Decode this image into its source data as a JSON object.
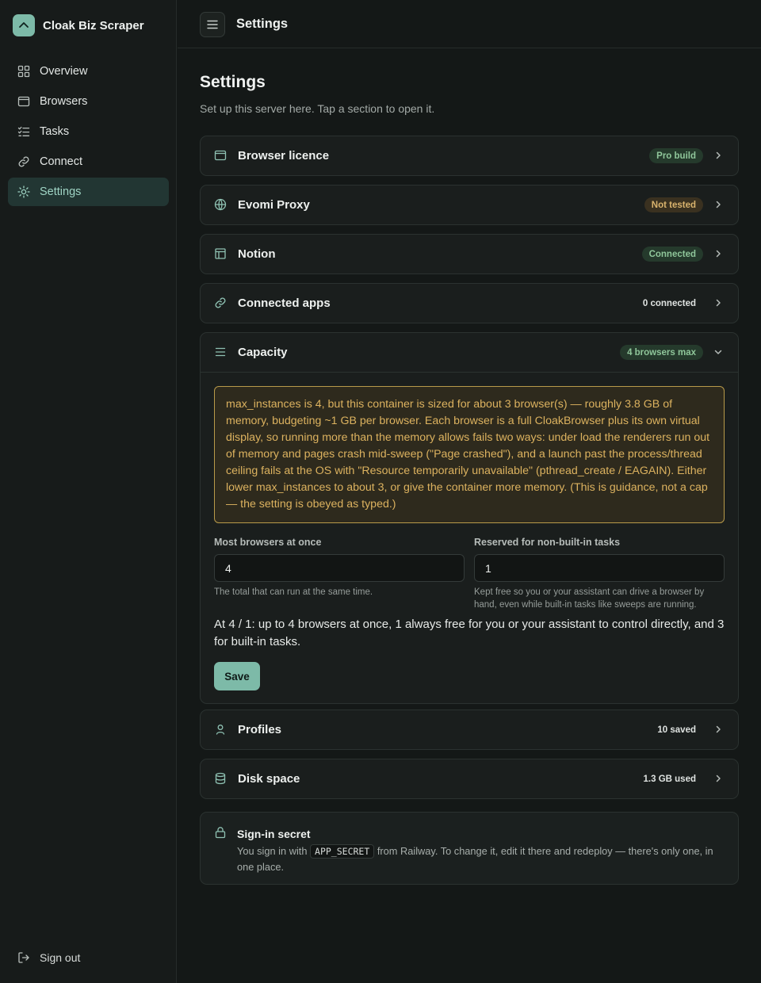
{
  "app": {
    "name": "Cloak Biz Scraper"
  },
  "sidebar": {
    "items": [
      {
        "label": "Overview",
        "icon": "grid-icon"
      },
      {
        "label": "Browsers",
        "icon": "browser-window-icon"
      },
      {
        "label": "Tasks",
        "icon": "checklist-icon"
      },
      {
        "label": "Connect",
        "icon": "link-icon"
      },
      {
        "label": "Settings",
        "icon": "sun-gear-icon",
        "active": true
      }
    ],
    "sign_out": "Sign out"
  },
  "topbar": {
    "title": "Settings"
  },
  "page": {
    "title": "Settings",
    "subtitle": "Set up this server here. Tap a section to open it."
  },
  "sections": {
    "browser_licence": {
      "title": "Browser licence",
      "badge": "Pro build"
    },
    "evomi_proxy": {
      "title": "Evomi Proxy",
      "badge": "Not tested"
    },
    "notion": {
      "title": "Notion",
      "badge": "Connected"
    },
    "connected_apps": {
      "title": "Connected apps",
      "badge": "0 connected"
    },
    "capacity": {
      "title": "Capacity",
      "badge": "4 browsers max",
      "warning": "max_instances is 4, but this container is sized for about 3 browser(s) — roughly 3.8 GB of memory, budgeting ~1 GB per browser. Each browser is a full CloakBrowser plus its own virtual display, so running more than the memory allows fails two ways: under load the renderers run out of memory and pages crash mid-sweep (\"Page crashed\"), and a launch past the process/thread ceiling fails at the OS with \"Resource temporarily unavailable\" (pthread_create / EAGAIN). Either lower max_instances to about 3, or give the container more memory. (This is guidance, not a cap — the setting is obeyed as typed.)",
      "max_label": "Most browsers at once",
      "max_value": "4",
      "max_help": "The total that can run at the same time.",
      "reserved_label": "Reserved for non-built-in tasks",
      "reserved_value": "1",
      "reserved_help": "Kept free so you or your assistant can drive a browser by hand, even while built-in tasks like sweeps are running.",
      "summary": "At 4 / 1: up to 4 browsers at once, 1 always free for you or your assistant to control directly, and 3 for built-in tasks.",
      "save_label": "Save"
    },
    "profiles": {
      "title": "Profiles",
      "badge": "10 saved"
    },
    "disk_space": {
      "title": "Disk space",
      "badge": "1.3 GB used"
    }
  },
  "secret": {
    "title": "Sign-in secret",
    "text_before": "You sign in with",
    "code": "APP_SECRET",
    "text_after": "from Railway. To change it, edit it there and redeploy — there's only one, in one place."
  }
}
